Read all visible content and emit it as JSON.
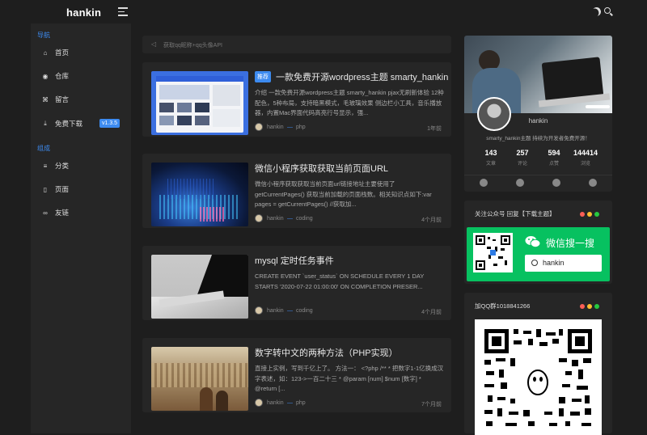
{
  "app": {
    "brand": "hankin"
  },
  "sidebar": {
    "section_nav": "导航",
    "section_group": "组成",
    "items": [
      {
        "label": "首页",
        "icon": "home-icon",
        "glyph": "⌂"
      },
      {
        "label": "仓库",
        "icon": "github-icon",
        "glyph": "◉"
      },
      {
        "label": "留言",
        "icon": "command-icon",
        "glyph": "⌘"
      },
      {
        "label": "免费下载",
        "icon": "download-icon",
        "glyph": "⤓",
        "badge": "v1.3.5"
      },
      {
        "label": "分类",
        "icon": "menu-icon",
        "glyph": "≡"
      },
      {
        "label": "页面",
        "icon": "page-icon",
        "glyph": "▯"
      },
      {
        "label": "友链",
        "icon": "link-icon",
        "glyph": "∞"
      }
    ]
  },
  "notice": {
    "text": "获取qq昵称+qq头像API",
    "icon": "speaker-icon"
  },
  "posts": [
    {
      "tag": "推荐",
      "title": "一款免费开源wordpress主题 smarty_hankin",
      "excerpt": "介绍 一款免费开源wordpress主题 smarty_hankin pjax无刷新体验 12种配色，5种布局，支持暗黑模式，毛玻璃效果 侧边栏小工具，音乐播放器，内置Mac界面代码高亮行号显示，强...",
      "author": "hankin",
      "category": "php",
      "time": "1年前"
    },
    {
      "tag": "",
      "title": "微信小程序获取获取当前页面URL",
      "excerpt": "微信小程序获取获取当前页面url链接地址主要使用了getCurrentPages() 获取当前加载的页面栈数。相关知识点如下:var pages = getCurrentPages() //获取加...",
      "author": "hankin",
      "category": "coding",
      "time": "4个月前"
    },
    {
      "tag": "",
      "title": "mysql 定时任务事件",
      "excerpt": "CREATE EVENT `user_status` ON SCHEDULE EVERY 1 DAY STARTS '2020-07-22 01:00:00' ON COMPLETION PRESER...",
      "author": "hankin",
      "category": "coding",
      "time": "4个月前"
    },
    {
      "tag": "",
      "title": "数字转中文的两种方法（PHP实现）",
      "excerpt": "直接上实例，写到千亿上了。 方法一： <?php /** * 把数字1-1亿换成汉字表述，如：123->一百二十三 * @param [num] $num [数字] * @return [...",
      "author": "hankin",
      "category": "php",
      "time": "7个月前"
    }
  ],
  "profile": {
    "name": "hankin",
    "desc": "smarty_hankin主题 持续为开发者免费开源！",
    "stats": [
      {
        "value": "143",
        "label": "文章"
      },
      {
        "value": "257",
        "label": "评论"
      },
      {
        "value": "594",
        "label": "点赞"
      },
      {
        "value": "144414",
        "label": "浏览"
      }
    ],
    "socials": [
      "wechat-icon",
      "weibo-icon",
      "qq-icon",
      "github-icon"
    ]
  },
  "wechat_widget": {
    "title": "关注公众号 回复【下载主题】",
    "brand_text": "微信搜一搜",
    "search_value": "hankin"
  },
  "qq_widget": {
    "title": "加QQ群1018841266"
  },
  "colors": {
    "accent": "#3d8bf0",
    "wechat_green": "#07c160",
    "dot_red": "#ff5f56",
    "dot_yellow": "#ffbd2e",
    "dot_green": "#27c93f"
  }
}
